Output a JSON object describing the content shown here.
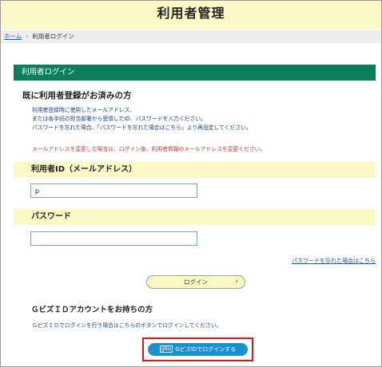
{
  "header": {
    "title": "利用者管理"
  },
  "breadcrumb": {
    "home": "ホーム",
    "separator": "›",
    "current": "利用者ログイン"
  },
  "section": {
    "title": "利用者ログイン"
  },
  "registered": {
    "heading": "既に利用者登録がお済みの方",
    "desc_line1": "利用者登録時に使用したメールアドレス、",
    "desc_line2": "または各手続の担当部署から受領したID、パスワードを入力ください。",
    "desc_line3": "パスワードを忘れた場合、「パスワードを忘れた場合はこちら」より再設定してください。",
    "warning": "メールアドレスを変更した場合は、ログイン後、利用者情報のメールアドレスを変更ください。"
  },
  "user_id": {
    "label": "利用者ID（メールアドレス）",
    "value": "p"
  },
  "password": {
    "label": "パスワード",
    "value": ""
  },
  "forgot_link": "パスワードを忘れた場合はこちら",
  "login_button": {
    "label": "ログイン",
    "chevron": "›"
  },
  "gbiz": {
    "heading": "ＧビズＩＤアカウントをお持ちの方",
    "desc": "ＧビズＩＤでログインを行う場合はこちらのボタンでログインしてください。",
    "button_label": "GビズIDでログインする",
    "icon_text": "gBiz"
  },
  "colors": {
    "header_bg": "#fbf8c6",
    "title_bar": "#0b7f5a",
    "gbiz_button": "#1a8fd1",
    "highlight_box": "#e0161b"
  }
}
